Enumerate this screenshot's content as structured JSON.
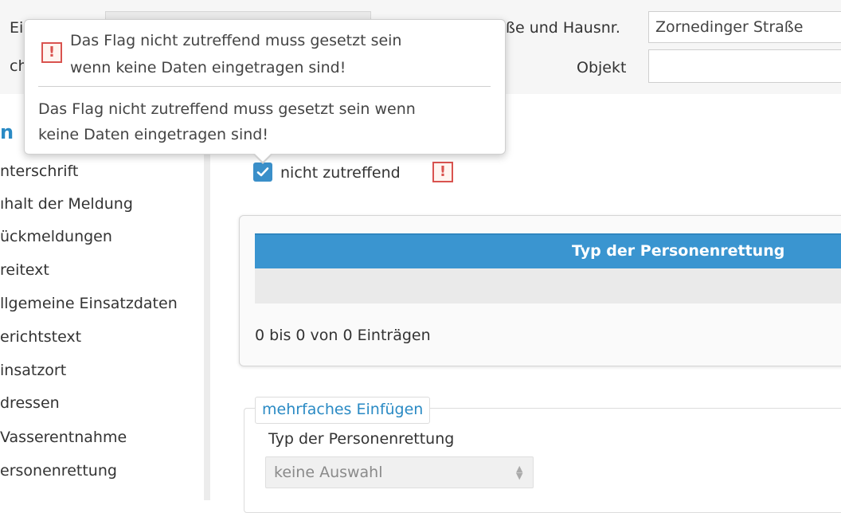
{
  "header": {
    "left_label_1": "Ei",
    "left_label_2": "ch",
    "street_label": "ße und Hausnr.",
    "street_value": "Zornedinger Straße",
    "object_label": "Objekt",
    "object_value": ""
  },
  "sidebar": {
    "heading": "n",
    "items": [
      {
        "label": "nterschrift"
      },
      {
        "label": "ıhalt der Meldung"
      },
      {
        "label": "ückmeldungen"
      },
      {
        "label": "reitext"
      },
      {
        "label": "llgemeine Einsatzdaten"
      },
      {
        "label": "erichtstext"
      },
      {
        "label": "insatzort"
      },
      {
        "label": "dressen"
      },
      {
        "label": "Vasserentnahme"
      },
      {
        "label": "ersonenrettung"
      }
    ]
  },
  "checkbox": {
    "label": "nicht zutreffend",
    "checked": true,
    "warning_symbol": "!"
  },
  "table": {
    "column_header": "Typ der Personenrettung",
    "info": "0 bis 0 von 0 Einträgen"
  },
  "multi_insert": {
    "legend": "mehrfaches Einfügen",
    "field_label": "Typ der Personenrettung",
    "select_value": "keine Auswahl"
  },
  "tooltip": {
    "title_line_1": "Das Flag nicht zutreffend muss gesetzt sein",
    "title_line_2": "wenn keine Daten eingetragen sind!",
    "body_line_1": "Das Flag nicht zutreffend muss gesetzt sein wenn",
    "body_line_2": "keine Daten eingetragen sind!",
    "icon_symbol": "!"
  },
  "colors": {
    "accent_blue": "#3a95d0",
    "link_blue": "#2a8ac4",
    "warning_red": "#d9534f"
  }
}
